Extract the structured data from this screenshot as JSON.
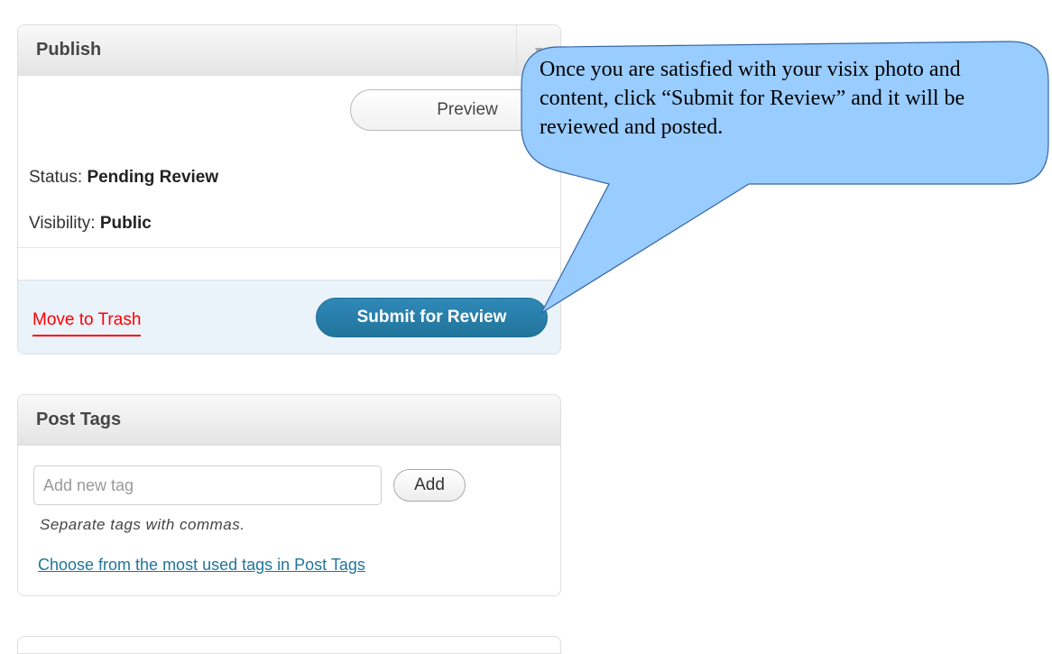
{
  "publish": {
    "title": "Publish",
    "preview_label": "Preview",
    "status_label": "Status:",
    "status_value": "Pending Review",
    "visibility_label": "Visibility:",
    "visibility_value": "Public",
    "trash_label": "Move to Trash",
    "submit_label": "Submit for Review",
    "toggle_icon": "triangle-down-icon"
  },
  "post_tags": {
    "title": "Post Tags",
    "input_placeholder": "Add new tag",
    "add_label": "Add",
    "hint": "Separate tags with commas.",
    "most_used_link": "Choose from the most used tags in Post Tags"
  },
  "callout": {
    "text": "Once you are satisfied with your visix photo and content, click “Submit for Review” and it will be reviewed and posted.",
    "fill_color": "#99ccff",
    "stroke_color": "#3465a4"
  },
  "colors": {
    "submit_button": "#21759b",
    "trash_link": "#ff0000",
    "actions_background": "#eaf2fa",
    "link": "#21759b"
  }
}
